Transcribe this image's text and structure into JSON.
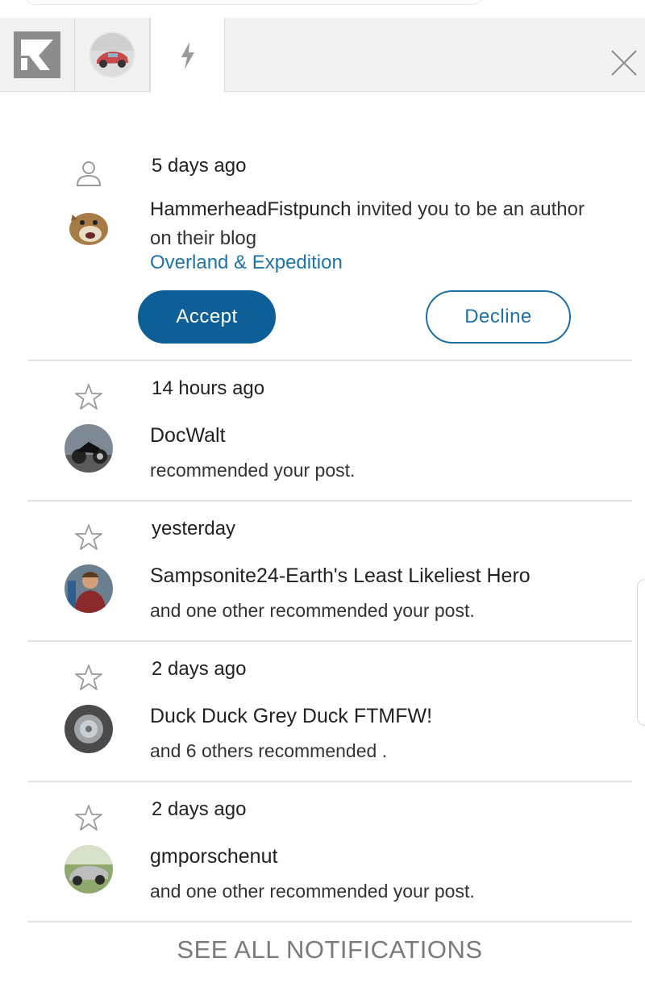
{
  "tabs": [
    {
      "name": "kinja-logo",
      "icon": "kinja-logo-icon"
    },
    {
      "name": "profile-avatar",
      "icon": "car-avatar"
    },
    {
      "name": "notifications",
      "icon": "lightning-bolt-icon",
      "active": true
    }
  ],
  "close_icon": "close-icon",
  "notifications": [
    {
      "kind_icon": "person-icon",
      "time": "5 days ago",
      "actor": "HammerheadFistpunch",
      "message": " invited you to be an author on their blog",
      "blog_link": "Overland & Expedition",
      "accept_label": "Accept",
      "decline_label": "Decline"
    },
    {
      "kind_icon": "star-icon",
      "time": "14 hours ago",
      "actor": "DocWalt",
      "message": "recommended your post."
    },
    {
      "kind_icon": "star-icon",
      "time": "yesterday",
      "actor": "Sampsonite24-Earth's Least Likeliest Hero",
      "message": "and one other recommended your post."
    },
    {
      "kind_icon": "star-icon",
      "time": "2 days ago",
      "actor": "Duck Duck Grey Duck FTMFW!",
      "message": "and 6 others recommended ."
    },
    {
      "kind_icon": "star-icon",
      "time": "2 days ago",
      "actor": "gmporschenut",
      "message": "and one other recommended your post."
    }
  ],
  "see_all_label": "SEE ALL NOTIFICATIONS",
  "colors": {
    "accent": "#0e5f98",
    "link": "#1e73a8",
    "divider": "#e3e3e3",
    "tabbar": "#f2f2f2"
  }
}
